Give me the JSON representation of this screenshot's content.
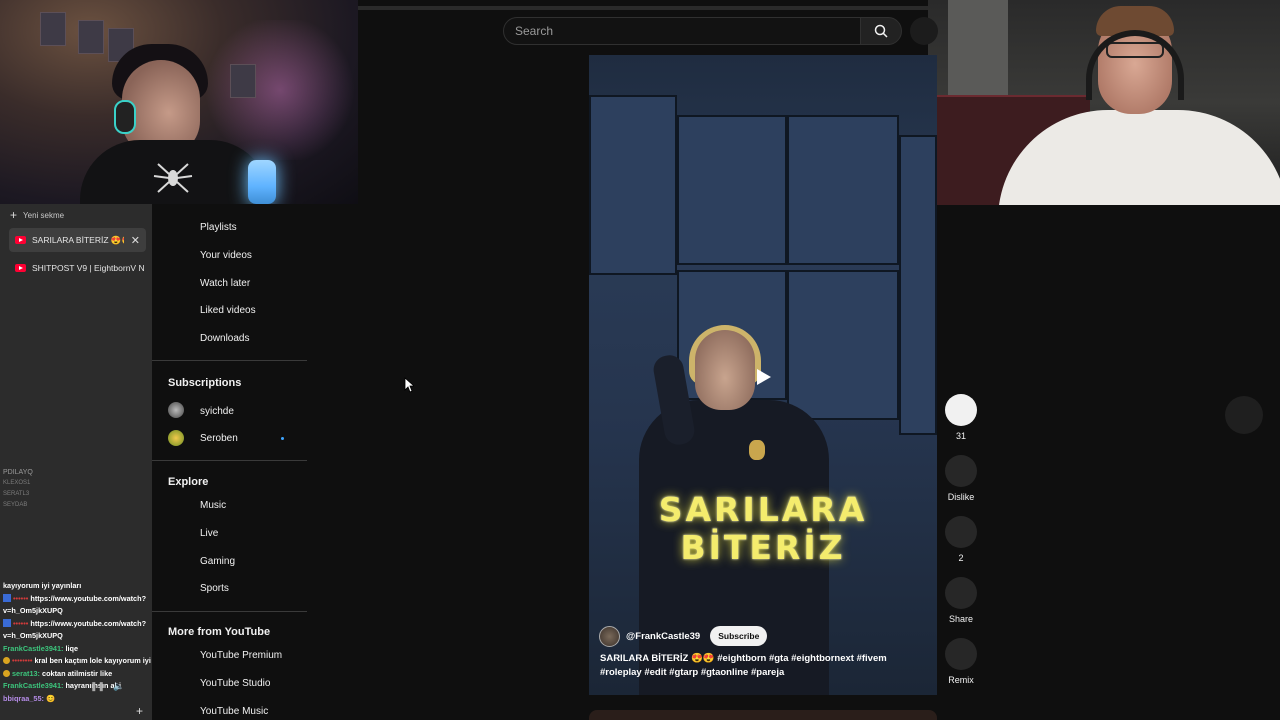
{
  "search": {
    "placeholder": "Search"
  },
  "browser_tabs": {
    "new_tab_label": "Yeni sekme",
    "tabs": [
      {
        "title": "SARILARA BİTERİZ 😍😍 #",
        "active": true
      },
      {
        "title": "SHITPOST V9 | EightbornV Ne:",
        "active": false
      }
    ]
  },
  "sidebar": {
    "you_items": [
      "Playlists",
      "Your videos",
      "Watch later",
      "Liked videos",
      "Downloads"
    ],
    "subscriptions_heading": "Subscriptions",
    "subscriptions": [
      {
        "name": "syichde",
        "new": false
      },
      {
        "name": "Seroben",
        "new": true
      }
    ],
    "explore_heading": "Explore",
    "explore_items": [
      "Music",
      "Live",
      "Gaming",
      "Sports"
    ],
    "more_heading": "More from YouTube",
    "more_items": [
      "YouTube Premium",
      "YouTube Studio",
      "YouTube Music"
    ]
  },
  "viewer_list": [
    "PDILAYQ",
    "KLEXOS1",
    "SERATL3",
    "SEYDAB"
  ],
  "chat": [
    {
      "user": "",
      "text": "kayıyorum iyi yayınları"
    },
    {
      "user": "••••••",
      "text": "https://www.youtube.com/watch?"
    },
    {
      "user": "",
      "text": "v=h_Om5jkXUPQ"
    },
    {
      "user": "••••••",
      "text": "https://www.youtube.com/watch?"
    },
    {
      "user": "",
      "text": "v=h_Om5jkXUPQ"
    },
    {
      "user": "FrankCastle3941:",
      "text": "liqe"
    },
    {
      "user": "••••••••",
      "text": "kral ben kaçtım lole kayıyorum iyi yayınlar"
    },
    {
      "user": "serat13:",
      "text": "coktan atilmistir like"
    },
    {
      "user": "FrankCastle3941:",
      "text": "hayranımsın abi"
    },
    {
      "user": "bbiqraa_55:",
      "text": "😊"
    }
  ],
  "short": {
    "overlay_title_line1": "SARILARA",
    "overlay_title_line2": "BİTERİZ",
    "channel": "@FrankCastle39",
    "subscribe_label": "Subscribe",
    "caption": "SARILARA BİTERİZ 😍😍",
    "hashtags": "#eightborn #gta #eightbornext #fivem #roleplay #edit #gtarp #gtaonline #pareja"
  },
  "actions": {
    "likes": "31",
    "dislike_label": "Dislike",
    "comments": "2",
    "share_label": "Share",
    "remix_label": "Remix"
  },
  "colors": {
    "background": "#0f0f0f",
    "youtube_red": "#ff0033",
    "overlay_yellow": "#f4ec6d",
    "chat_name_green": "#3cc47c"
  }
}
